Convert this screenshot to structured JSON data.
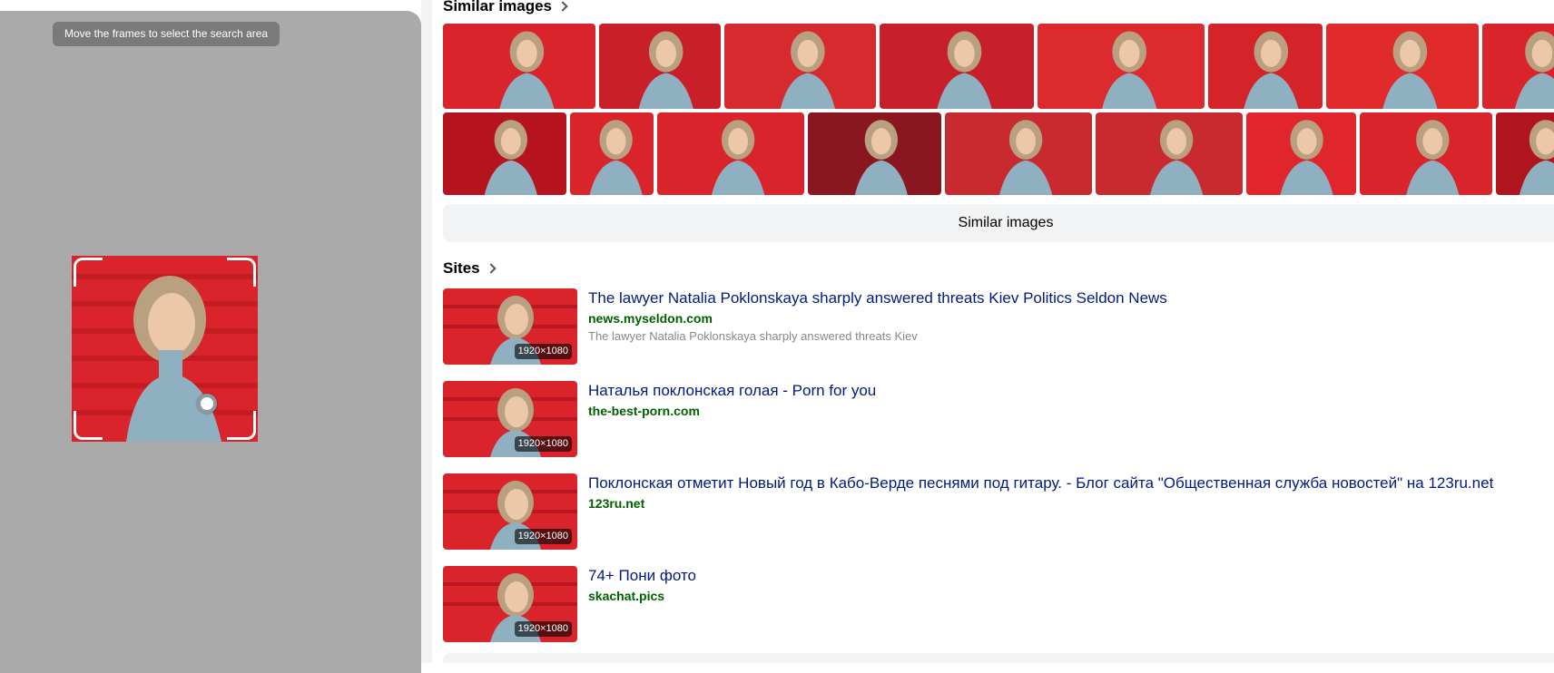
{
  "crop_panel": {
    "hint": "Move the frames to select the search area"
  },
  "similar": {
    "title": "Similar images",
    "button_label": "Similar images",
    "row1": [
      {
        "w": 168,
        "bg": "#d8242a"
      },
      {
        "w": 134,
        "bg": "#c81f28"
      },
      {
        "w": 167,
        "bg": "#d62a2e"
      },
      {
        "w": 170,
        "bg": "#c8202a"
      },
      {
        "w": 184,
        "bg": "#dc2a2e"
      },
      {
        "w": 126,
        "bg": "#d42429"
      },
      {
        "w": 168,
        "bg": "#e02a2c"
      },
      {
        "w": 120,
        "bg": "#d8242a"
      }
    ],
    "row2": [
      {
        "w": 136,
        "bg": "#b5141e"
      },
      {
        "w": 92,
        "bg": "#d8242a"
      },
      {
        "w": 162,
        "bg": "#d8242a"
      },
      {
        "w": 147,
        "bg": "#8a1620"
      },
      {
        "w": 162,
        "bg": "#c82a30"
      },
      {
        "w": 162,
        "bg": "#c82a30"
      },
      {
        "w": 121,
        "bg": "#e0262c"
      },
      {
        "w": 146,
        "bg": "#d8242a"
      },
      {
        "w": 100,
        "bg": "#b0141e"
      }
    ]
  },
  "sites": {
    "title": "Sites",
    "items": [
      {
        "title": "The lawyer Natalia Poklonskaya sharply answered threats Kiev Politics Seldon News",
        "domain": "news.myseldon.com",
        "desc": "The lawyer Natalia Poklonskaya sharply answered threats Kiev",
        "size": "1920×1080"
      },
      {
        "title": "Наталья поклонская голая - Porn for you",
        "domain": "the-best-porn.com",
        "desc": "",
        "size": "1920×1080"
      },
      {
        "title": "Поклонская отметит Новый год в Кабо-Верде песнями под гитару. - Блог сайта \"Общественная служба новостей\" на 123ru.net",
        "domain": "123ru.net",
        "desc": "",
        "size": "1920×1080"
      },
      {
        "title": "74+ Пони фото",
        "domain": "skachat.pics",
        "desc": "",
        "size": "1920×1080"
      }
    ]
  },
  "colors": {
    "link": "#001a80",
    "domain": "#006000",
    "accent_red": "#d8242a"
  }
}
